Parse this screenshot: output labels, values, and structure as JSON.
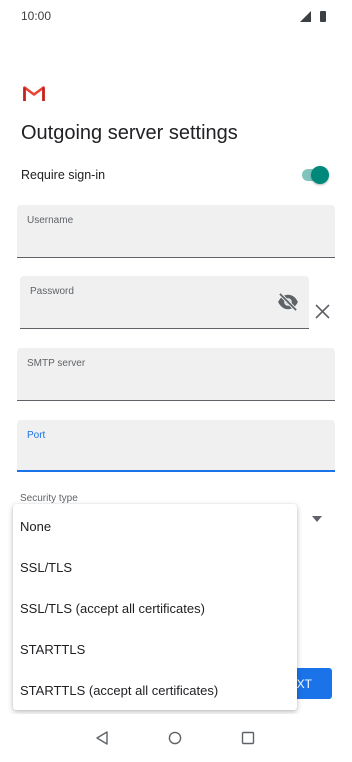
{
  "status_bar": {
    "time": "10:00"
  },
  "page": {
    "title": "Outgoing server settings"
  },
  "require_signin": {
    "label": "Require sign-in",
    "enabled": true
  },
  "fields": {
    "username": {
      "label": "Username",
      "value": ""
    },
    "password": {
      "label": "Password",
      "value": ""
    },
    "smtp_server": {
      "label": "SMTP server",
      "value": ""
    },
    "port": {
      "label": "Port",
      "value": ""
    }
  },
  "security": {
    "label": "Security type",
    "options": [
      "None",
      "SSL/TLS",
      "SSL/TLS (accept all certificates)",
      "STARTTLS",
      "STARTTLS (accept all certificates)"
    ]
  },
  "next_button": {
    "label": "XT"
  },
  "icons": {
    "logo": "gmail-logo",
    "password_toggle": "visibility-off-icon",
    "clear": "close-icon",
    "dropdown": "caret-down-icon",
    "nav_back": "back-icon",
    "nav_home": "home-icon",
    "nav_recents": "recents-icon"
  },
  "colors": {
    "accent": "#1a73e8",
    "toggle_on": "#00897b",
    "field_bg": "#f0f0f0"
  }
}
